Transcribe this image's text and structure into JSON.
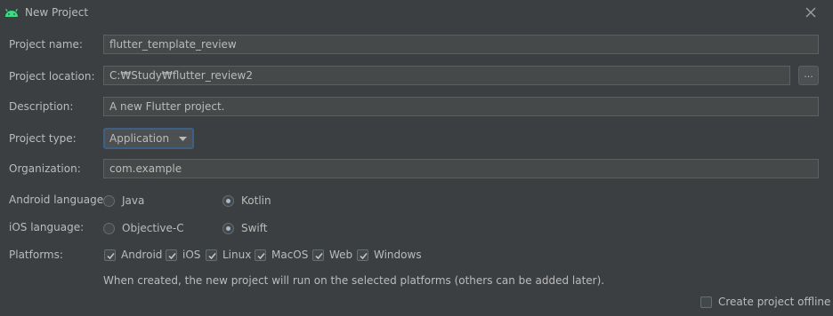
{
  "window": {
    "title": "New Project"
  },
  "form": {
    "project_name": {
      "label": "Project name:",
      "value": "flutter_template_review"
    },
    "project_location": {
      "label": "Project location:",
      "value": "C:₩Study₩flutter_review2",
      "browse_label": "..."
    },
    "description": {
      "label": "Description:",
      "value": "A new Flutter project."
    },
    "project_type": {
      "label": "Project type:",
      "value": "Application"
    },
    "organization": {
      "label": "Organization:",
      "value": "com.example"
    },
    "android_language": {
      "label": "Android language:",
      "options": [
        {
          "label": "Java",
          "selected": false
        },
        {
          "label": "Kotlin",
          "selected": true
        }
      ]
    },
    "ios_language": {
      "label": "iOS language:",
      "options": [
        {
          "label": "Objective-C",
          "selected": false
        },
        {
          "label": "Swift",
          "selected": true
        }
      ]
    },
    "platforms": {
      "label": "Platforms:",
      "items": [
        {
          "label": "Android",
          "checked": true
        },
        {
          "label": "iOS",
          "checked": true
        },
        {
          "label": "Linux",
          "checked": true
        },
        {
          "label": "MacOS",
          "checked": true
        },
        {
          "label": "Web",
          "checked": true
        },
        {
          "label": "Windows",
          "checked": true
        }
      ],
      "hint": "When created, the new project will run on the selected platforms (others can be added later)."
    },
    "offline": {
      "label": "Create project offline",
      "checked": false
    }
  },
  "colors": {
    "background": "#3c3f41",
    "field_bg": "#45494a",
    "text": "#bbbbbb",
    "android_green": "#3ddc84",
    "focus_border": "#3d6185"
  }
}
